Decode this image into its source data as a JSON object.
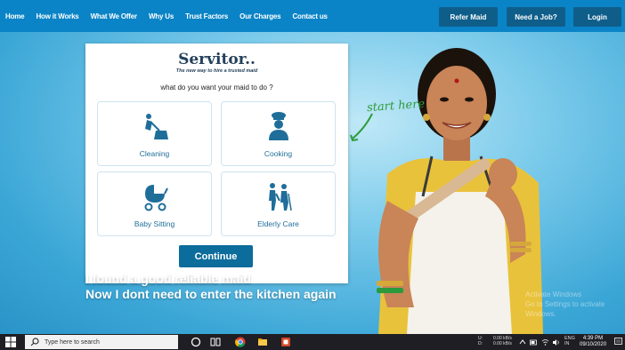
{
  "nav": {
    "links": [
      "Home",
      "How it Works",
      "What We Offer",
      "Why Us",
      "Trust Factors",
      "Our Charges",
      "Contact us"
    ],
    "refer_label": "Refer Maid",
    "job_label": "Need a Job?",
    "login_label": "Login"
  },
  "card": {
    "brand": "Servitor..",
    "tagline": "The new way to hire a trusted maid",
    "question": "what do you want your maid to do ?",
    "tiles": [
      {
        "label": "Cleaning",
        "icon": "broom-icon"
      },
      {
        "label": "Cooking",
        "icon": "chef-icon"
      },
      {
        "label": "Baby Sitting",
        "icon": "stroller-icon"
      },
      {
        "label": "Elderly Care",
        "icon": "elderly-icon"
      }
    ],
    "continue_label": "Continue"
  },
  "start_here": "start here",
  "testimonial": {
    "line1": "I found a good reliable maid",
    "line2": "Now I dont need to enter the kitchen again"
  },
  "watermark": {
    "line1": "Activate Windows",
    "line2": "Go to Settings to activate Windows."
  },
  "taskbar": {
    "search_placeholder": "Type here to search",
    "net_up": "0.00 kB/s",
    "net_down": "0.00 kB/s",
    "net_up_label": "U:",
    "net_down_label": "D:",
    "lang": "ENG",
    "region": "IN",
    "time": "4:39 PM",
    "date": "09/10/2020"
  },
  "colors": {
    "nav_bg": "#0a84c6",
    "nav_btn_bg": "#0f5e8a",
    "accent": "#0c6c9c",
    "tile_label": "#1f6e9a",
    "start_here": "#2f9c3a"
  }
}
